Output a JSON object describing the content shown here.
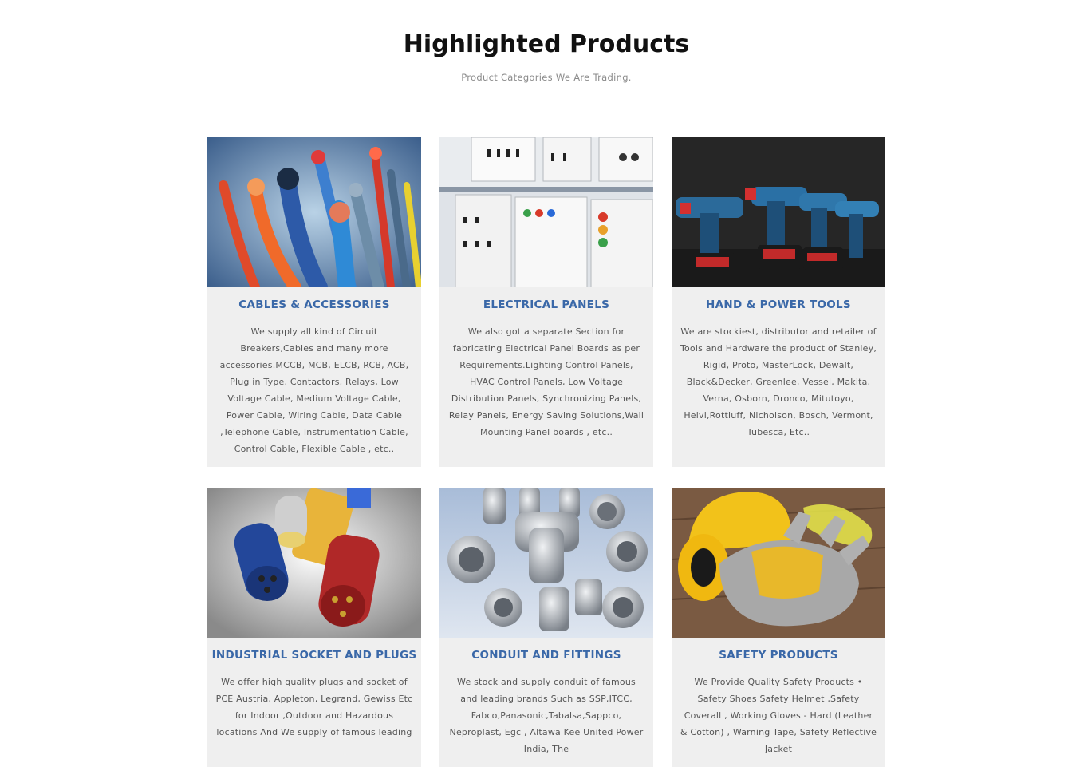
{
  "section": {
    "title": "Highlighted Products",
    "subtitle": "Product Categories We Are Trading."
  },
  "products": [
    {
      "title": "CABLES & ACCESSORIES",
      "description": "We supply all kind of Circuit Breakers,Cables and many more accessories.MCCB, MCB, ELCB, RCB, ACB, Plug in Type, Contactors, Relays, Low Voltage Cable, Medium Voltage Cable, Power Cable, Wiring Cable, Data Cable ,Telephone Cable, Instrumentation Cable, Control Cable, Flexible Cable , etc.."
    },
    {
      "title": "ELECTRICAL PANELS",
      "description": "We also got a separate Section for fabricating Electrical Panel Boards as per Requirements.Lighting Control Panels, HVAC Control Panels, Low Voltage Distribution Panels, Synchronizing Panels, Relay Panels, Energy Saving Solutions,Wall Mounting Panel boards , etc.."
    },
    {
      "title": "HAND & POWER TOOLS",
      "description": "We are stockiest, distributor and retailer of Tools and Hardware the product of Stanley, Rigid, Proto, MasterLock, Dewalt, Black&Decker, Greenlee, Vessel, Makita, Verna, Osborn, Dronco, Mitutoyo, Helvi,Rottluff, Nicholson, Bosch, Vermont, Tubesca, Etc.."
    },
    {
      "title": "INDUSTRIAL SOCKET AND PLUGS",
      "description": "We offer high quality plugs and socket of PCE Austria, Appleton, Legrand, Gewiss Etc for Indoor ,Outdoor and Hazardous locations And We supply of famous leading"
    },
    {
      "title": "CONDUIT AND FITTINGS",
      "description": "We stock and supply conduit of famous and leading brands Such as SSP,ITCC, Fabco,Panasonic,Tabalsa,Sappco, Neproplast, Egc , Altawa Kee United Power India, The"
    },
    {
      "title": "SAFETY PRODUCTS",
      "description": "We Provide Quality Safety Products • Safety Shoes Safety Helmet ,Safety Coverall , Working Gloves - Hard (Leather & Cotton) , Warning Tape, Safety Reflective Jacket"
    }
  ]
}
